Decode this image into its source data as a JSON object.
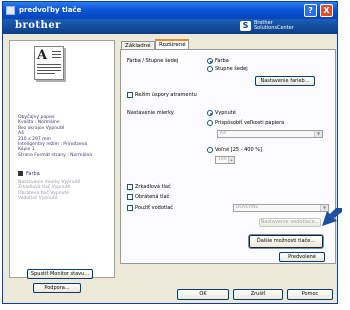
{
  "window": {
    "title": "predvoľby tlače",
    "help": "?",
    "close": "X"
  },
  "banner": {
    "brand": "brother",
    "solutions_line1": "Brother",
    "solutions_line2": "SolutionsCenter",
    "solutions_badge": "S"
  },
  "summary": {
    "preview_letter": "A",
    "lines": [
      "Obyčajný papier",
      "Kvalita : Normálne",
      "Bez okrajov Vypnuté",
      "A4",
      "210 x 297 mm",
      "Inteligentný režim : Prirodzená",
      "Kópie 1",
      "Strana Formát strany : Normálna"
    ],
    "color_label": "Farba",
    "grey_lines": [
      "Nastavenie mierky Vypnuté",
      "Zrkadlová tlač Vypnuté",
      "Obrátená tlač Vypnuté",
      "Vodotlač Vypnuté"
    ]
  },
  "tabs": [
    "Základné",
    "Rozšírené"
  ],
  "advanced": {
    "color_label": "Farba / Stupne šedej",
    "color_option": "Farba",
    "gray_option": "Stupne šedej",
    "color_settings_button": "Nastavenie farieb...",
    "ink_save_label": "Režim úspory atramentu",
    "scaling_label": "Nastavenie mierky",
    "scaling_off": "Vypnuté",
    "fit_page": "Prispôsobiť veľkosti papiera",
    "paper_size": "A4",
    "free_label": "Voľné [25 - 400 %]",
    "free_value": "100",
    "mirror_label": "Zrkadlová tlač",
    "reverse_label": "Obrátená tlač",
    "watermark_label": "Použiť vodotlač",
    "watermark_value": "DÔVERNÉ",
    "watermark_settings_button": "Nastavenie vodotlače...",
    "other_options_button": "Ďalšie možnosti tlače...",
    "default_button": "Predvolené"
  },
  "left_buttons": {
    "status_monitor": "Spustiť Monitor stavu...",
    "support": "Podpora..."
  },
  "bottom": {
    "ok": "OK",
    "cancel": "Zrušiť",
    "help": "Pomoc"
  },
  "colors": {
    "title_blue": "#0a55d8",
    "banner_blue": "#0d3d86",
    "tab_accent": "#e68b2c",
    "arrow_blue": "#1d4fa3"
  }
}
